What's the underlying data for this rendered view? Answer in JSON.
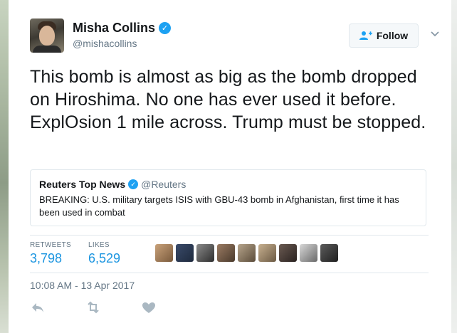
{
  "author": {
    "name": "Misha Collins",
    "handle": "@mishacollins",
    "verified_icon": "verified-badge-icon"
  },
  "follow_button": {
    "label": "Follow",
    "icon": "add-user-icon"
  },
  "menu_icon": "chevron-down-icon",
  "tweet": {
    "text": "This bomb is almost as big as the bomb dropped on Hiroshima. No one has ever used it before. ExplOsion 1 mile across. Trump must be stopped."
  },
  "quoted_tweet": {
    "name": "Reuters Top News",
    "handle": "@Reuters",
    "text": "BREAKING: U.S. military targets ISIS with GBU-43 bomb in Afghanistan, first time it has been used in combat"
  },
  "stats": {
    "retweets_label": "RETWEETS",
    "retweets_value": "3,798",
    "likes_label": "LIKES",
    "likes_value": "6,529"
  },
  "timestamp": "10:08 AM - 13 Apr 2017",
  "actions": {
    "reply_icon": "reply-icon",
    "retweet_icon": "retweet-icon",
    "like_icon": "heart-icon"
  },
  "colors": {
    "accent": "#1da1f2",
    "link": "#1b95e0",
    "muted": "#657786",
    "border": "#e1e8ed"
  }
}
